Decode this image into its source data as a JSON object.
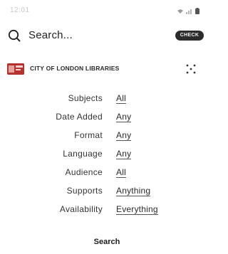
{
  "status_bar": {
    "time": "12:01"
  },
  "search": {
    "label": "Search...",
    "pill_label": "CHECK"
  },
  "library": {
    "name": "CITY OF LONDON LIBRARIES"
  },
  "filters": [
    {
      "label": "Subjects",
      "value": "All"
    },
    {
      "label": "Date Added",
      "value": "Any"
    },
    {
      "label": "Format",
      "value": "Any"
    },
    {
      "label": "Language",
      "value": "Any"
    },
    {
      "label": "Audience",
      "value": "All"
    },
    {
      "label": "Supports",
      "value": "Anything"
    },
    {
      "label": "Availability",
      "value": "Everything"
    }
  ],
  "action": {
    "search_button_label": "Search"
  },
  "colors": {
    "logo_red": "#b8322d",
    "pill_bg": "#2c2c2c"
  },
  "icons": {
    "search": "search-icon",
    "apps": "apps-icon",
    "wifi": "wifi-icon",
    "signal": "signal-icon",
    "battery": "battery-icon"
  }
}
